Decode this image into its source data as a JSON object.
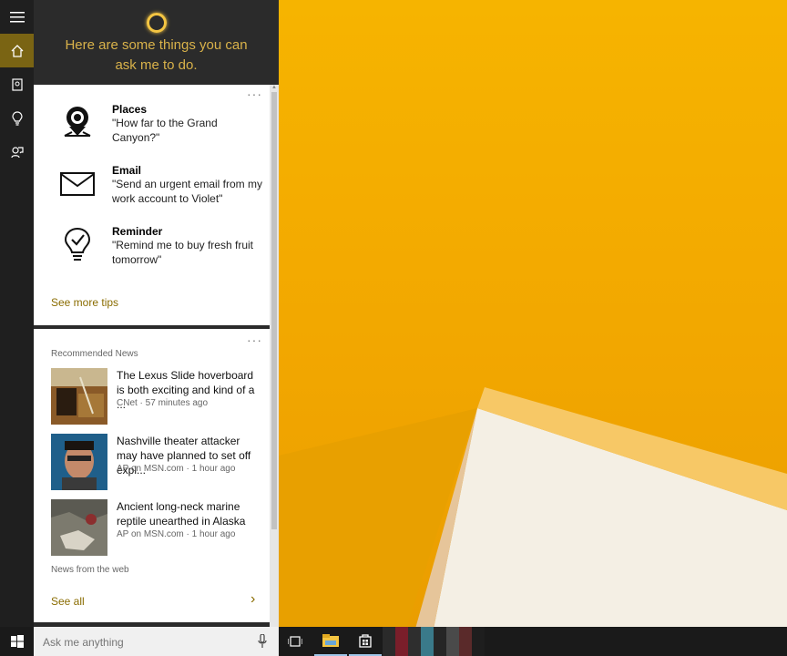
{
  "cortana": {
    "greeting_line1": "Here are some things you can",
    "greeting_line2": "ask me to do.",
    "ring_color": "#f4c542"
  },
  "rail": {
    "items": [
      {
        "icon": "hamburger-menu-icon",
        "active": false
      },
      {
        "icon": "home-icon",
        "active": true
      },
      {
        "icon": "notebook-icon",
        "active": false
      },
      {
        "icon": "lightbulb-icon",
        "active": false
      },
      {
        "icon": "feedback-icon",
        "active": false
      }
    ]
  },
  "tips_card": {
    "more": "···",
    "items": [
      {
        "icon": "places-pin-icon",
        "title": "Places",
        "text": "\"How far to the Grand Canyon?\""
      },
      {
        "icon": "email-envelope-icon",
        "title": "Email",
        "text": "\"Send an urgent email from my work account to Violet\""
      },
      {
        "icon": "reminder-bulb-icon",
        "title": "Reminder",
        "text": "\"Remind me to buy fresh fruit tomorrow\""
      }
    ],
    "see_more": "See more tips"
  },
  "news_card": {
    "more": "···",
    "label": "Recommended News",
    "items": [
      {
        "title": "The Lexus Slide hoverboard is both exciting and kind of a ...",
        "meta": "CNet · 57 minutes ago"
      },
      {
        "title": "Nashville theater attacker may have planned to set off expl...",
        "meta": "AP on MSN.com · 1 hour ago"
      },
      {
        "title": "Ancient long-neck marine reptile unearthed in Alaska",
        "meta": "AP on MSN.com · 1 hour ago"
      }
    ],
    "web_label": "News from the web",
    "see_all": "See all"
  },
  "taskbar": {
    "search_placeholder": "Ask me anything",
    "accent": "#9ec5e8"
  },
  "colors": {
    "accent_gold": "#8a6c00",
    "rail_active": "#7a6413",
    "wallpaper": "#f2a900"
  }
}
